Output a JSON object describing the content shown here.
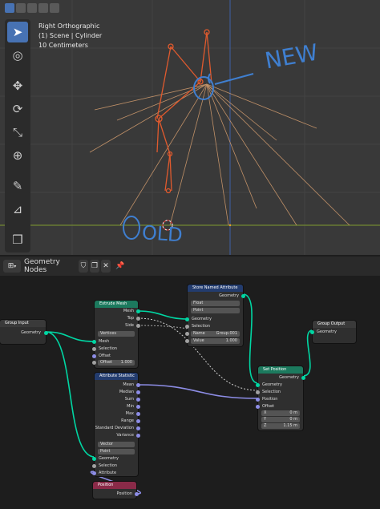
{
  "viewport": {
    "info_lines": [
      "Right Orthographic",
      "(1) Scene | Cylinder",
      "10 Centimeters"
    ],
    "annotation_new": "NEW",
    "annotation_old": "OLD",
    "tools": [
      "cursor-select-icon",
      "cursor-3d-icon",
      "move-icon",
      "rotate-icon",
      "scale-icon",
      "transform-icon",
      "annotate-icon",
      "measure-icon",
      "add-cube-icon"
    ]
  },
  "header": {
    "editor_type": "Geometry Nodes",
    "tree_name": "Geometry Nodes"
  },
  "nodes": {
    "group_input": {
      "title": "Group Input",
      "geometry": "Geometry"
    },
    "extrude": {
      "title": "Extrude Mesh",
      "out_mesh": "Mesh",
      "out_top": "Top",
      "out_side": "Side",
      "mode": "Vertices",
      "in_mesh": "Mesh",
      "in_selection": "Selection",
      "in_offset": "Offset",
      "offset_scale_label": "Offset",
      "offset_scale_value": "1.000"
    },
    "store": {
      "title": "Store Named Attribute",
      "out_geometry": "Geometry",
      "type": "Float",
      "domain": "Point",
      "in_geometry": "Geometry",
      "in_selection": "Selection",
      "name_label": "Name",
      "name_value": "Group.001",
      "value_label": "Value",
      "value_value": "1.000"
    },
    "group_output": {
      "title": "Group Output",
      "geometry": "Geometry"
    },
    "stats": {
      "title": "Attribute Statistic",
      "outputs": [
        "Mean",
        "Median",
        "Sum",
        "Min",
        "Max",
        "Range",
        "Standard Deviation",
        "Variance"
      ],
      "type": "Vector",
      "domain": "Point",
      "in_geometry": "Geometry",
      "in_selection": "Selection",
      "in_attribute": "Attribute"
    },
    "set_position": {
      "title": "Set Position",
      "out_geometry": "Geometry",
      "in_geometry": "Geometry",
      "in_selection": "Selection",
      "in_position": "Position",
      "in_offset": "Offset",
      "x_label": "X",
      "x_value": "0 m",
      "y_label": "Y",
      "y_value": "0 m",
      "z_label": "Z",
      "z_value": "1.15 m"
    },
    "position": {
      "title": "Position",
      "out": "Position"
    }
  },
  "colors": {
    "geometry_socket": "#00d6a3",
    "vector_socket": "#8d8de6",
    "float_socket": "#a1a1a1",
    "node_geometry_header": "#1c7a5e",
    "node_attribute_header": "#233c6e",
    "node_input_header": "#8a2a48",
    "accent": "#4772b3",
    "armature": "#e05a2e",
    "annotation": "#3f7fd0"
  }
}
